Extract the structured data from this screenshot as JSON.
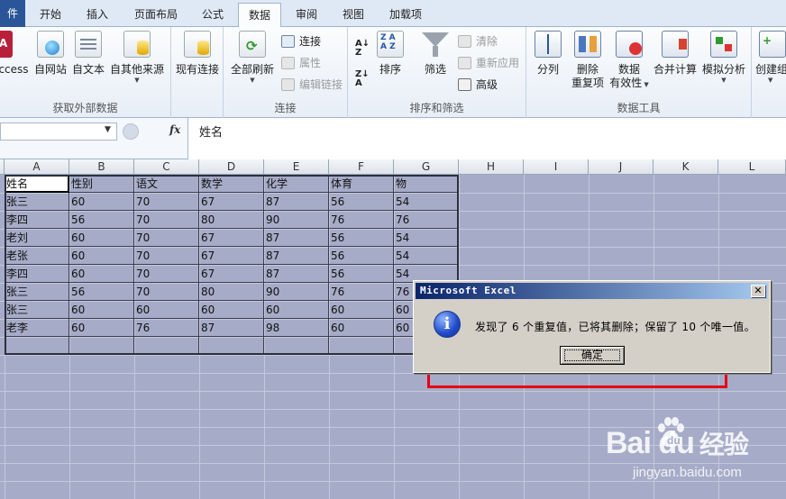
{
  "tabs": [
    {
      "label": "件",
      "active": false
    },
    {
      "label": "开始",
      "active": false
    },
    {
      "label": "插入",
      "active": false
    },
    {
      "label": "页面布局",
      "active": false
    },
    {
      "label": "公式",
      "active": false
    },
    {
      "label": "数据",
      "active": true
    },
    {
      "label": "审阅",
      "active": false
    },
    {
      "label": "视图",
      "active": false
    },
    {
      "label": "加载项",
      "active": false
    }
  ],
  "ribbon": {
    "external": {
      "group_label": "获取外部数据",
      "access": "ccess",
      "web": "自网站",
      "text": "自文本",
      "other": "自其他来源",
      "existing": "现有连接"
    },
    "connections": {
      "group_label": "连接",
      "refresh_all": "全部刷新",
      "connections": "连接",
      "properties": "属性",
      "edit_links": "编辑链接"
    },
    "sort_filter": {
      "group_label": "排序和筛选",
      "sort": "排序",
      "filter": "筛选",
      "clear": "清除",
      "reapply": "重新应用",
      "advanced": "高级"
    },
    "data_tools": {
      "group_label": "数据工具",
      "text_to_columns": "分列",
      "remove_dup_1": "删除",
      "remove_dup_2": "重复项",
      "validation_1": "数据",
      "validation_2": "有效性",
      "consolidate": "合并计算",
      "what_if": "模拟分析"
    },
    "outline": {
      "create_group": "创建组"
    }
  },
  "formula_bar": {
    "fx": "fx",
    "content": "姓名"
  },
  "columns": [
    "A",
    "B",
    "C",
    "D",
    "E",
    "F",
    "G",
    "H",
    "I",
    "J",
    "K",
    "L"
  ],
  "table": {
    "headers": [
      "姓名",
      "性别",
      "语文",
      "数学",
      "化学",
      "体育",
      "物"
    ],
    "rows": [
      [
        "张三",
        "60",
        "70",
        "67",
        "87",
        "56",
        "54"
      ],
      [
        "李四",
        "56",
        "70",
        "80",
        "90",
        "76",
        "76"
      ],
      [
        "老刘",
        "60",
        "70",
        "67",
        "87",
        "56",
        "54"
      ],
      [
        "老张",
        "60",
        "70",
        "67",
        "87",
        "56",
        "54"
      ],
      [
        "李四",
        "60",
        "70",
        "67",
        "87",
        "56",
        "54"
      ],
      [
        "张三",
        "56",
        "70",
        "80",
        "90",
        "76",
        "76"
      ],
      [
        "张三",
        "60",
        "60",
        "60",
        "60",
        "60",
        "60"
      ],
      [
        "老李",
        "60",
        "76",
        "87",
        "98",
        "60",
        "60"
      ]
    ]
  },
  "dialog": {
    "title": "Microsoft Excel",
    "close": "✕",
    "info_icon": "i",
    "message": "发现了 6 个重复值，已将其删除；保留了 10 个唯一值。",
    "ok": "确定"
  },
  "watermark": {
    "brand": "Bai  du",
    "brand_cn": "经验",
    "url": "jingyan.baidu.com"
  },
  "colors": {
    "tab_file": "#2a5699",
    "sheet_bg": "#a6acc8",
    "highlight": "#e60012",
    "dialog_title": "#0a246a"
  }
}
